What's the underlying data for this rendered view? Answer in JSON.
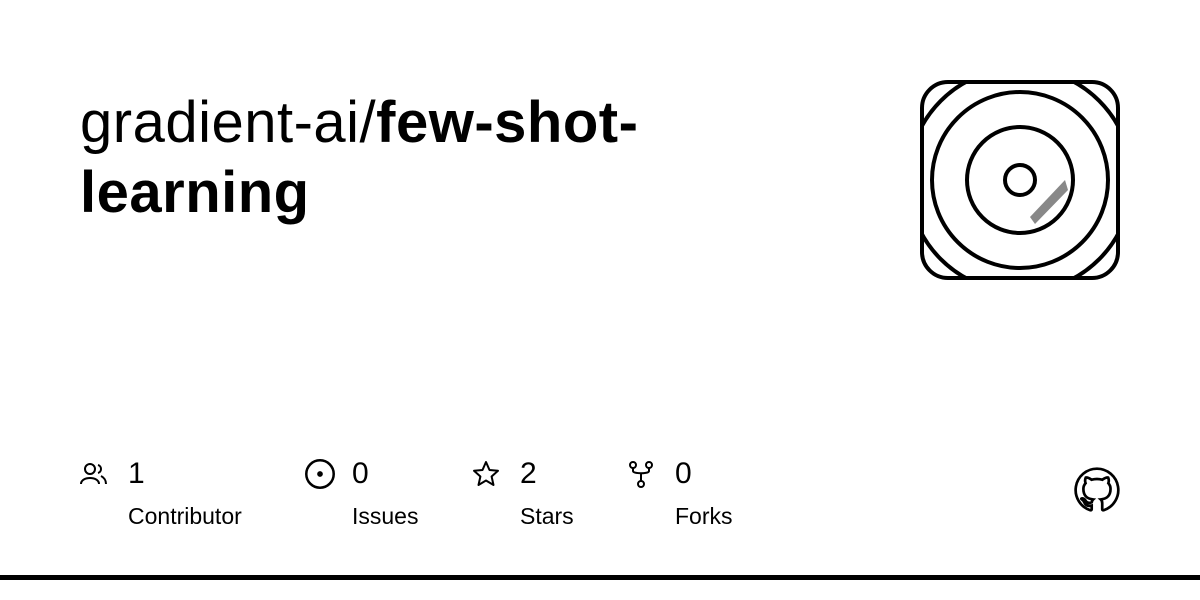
{
  "repo": {
    "owner": "gradient-ai/",
    "name": "few-shot-learning"
  },
  "stats": [
    {
      "icon": "people-icon",
      "value": "1",
      "label": "Contributor"
    },
    {
      "icon": "issue-icon",
      "value": "0",
      "label": "Issues"
    },
    {
      "icon": "star-icon",
      "value": "2",
      "label": "Stars"
    },
    {
      "icon": "fork-icon",
      "value": "0",
      "label": "Forks"
    }
  ]
}
